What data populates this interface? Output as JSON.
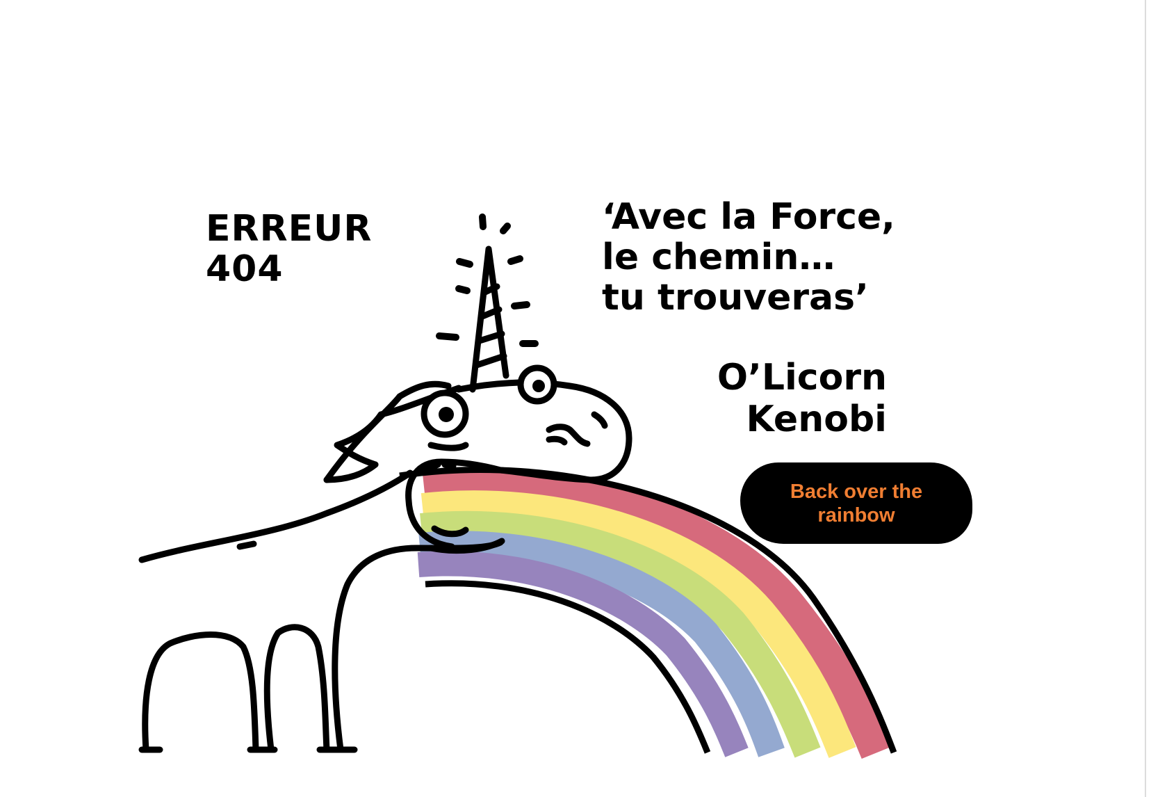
{
  "error": {
    "line1": "ERREUR",
    "line2": "404"
  },
  "quote": {
    "line1": "‘Avec la Force,",
    "line2": "le chemin…",
    "line3": "tu trouveras’"
  },
  "author": {
    "line1": "O’Licorn",
    "line2": "Kenobi"
  },
  "button": {
    "line1": "Back over the",
    "line2": "rainbow"
  },
  "colors": {
    "button_background": "#000000",
    "button_text": "#f07e32",
    "rainbow": [
      "#d66a7c",
      "#fce77c",
      "#c8dd7a",
      "#94a9d0",
      "#9784bd"
    ]
  },
  "illustration": {
    "icon": "unicorn-rainbow-illustration"
  }
}
